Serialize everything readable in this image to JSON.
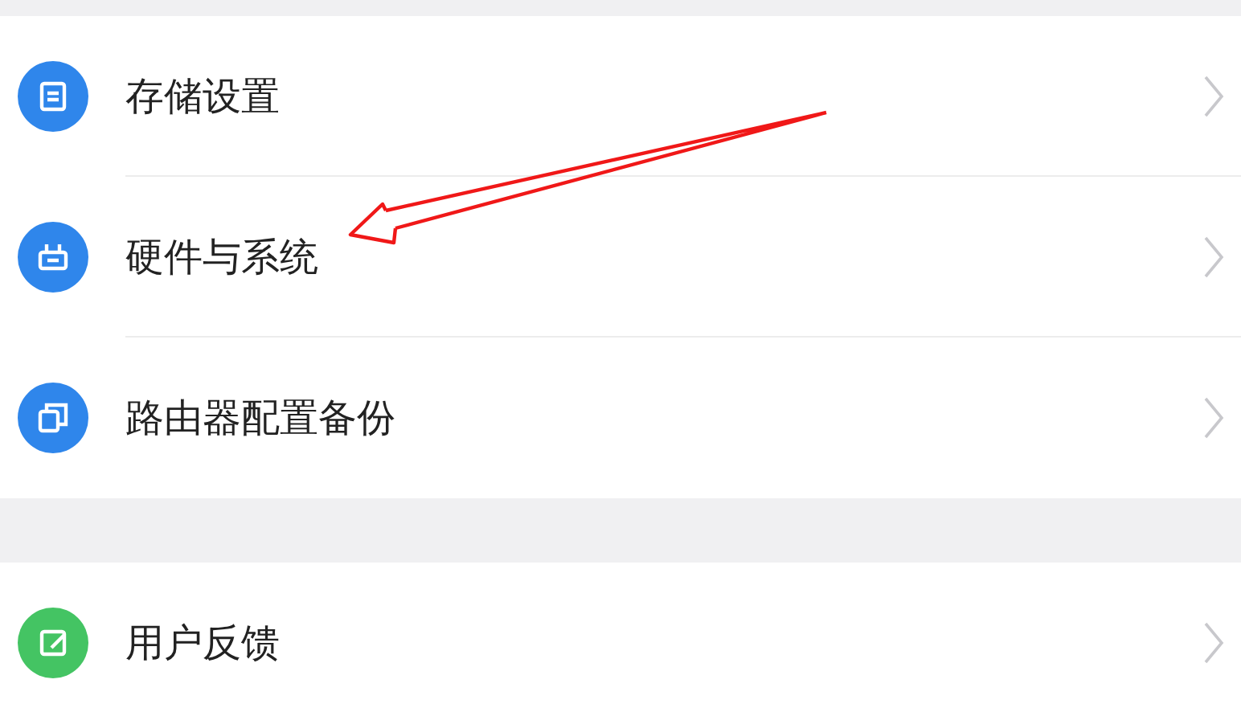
{
  "groups": [
    {
      "items": [
        {
          "label": "存储设置",
          "color": "#2f86eb"
        },
        {
          "label": "硬件与系统",
          "color": "#2f86eb"
        },
        {
          "label": "路由器配置备份",
          "color": "#2f86eb"
        }
      ]
    },
    {
      "items": [
        {
          "label": "用户反馈",
          "color": "#44c463"
        }
      ]
    }
  ]
}
